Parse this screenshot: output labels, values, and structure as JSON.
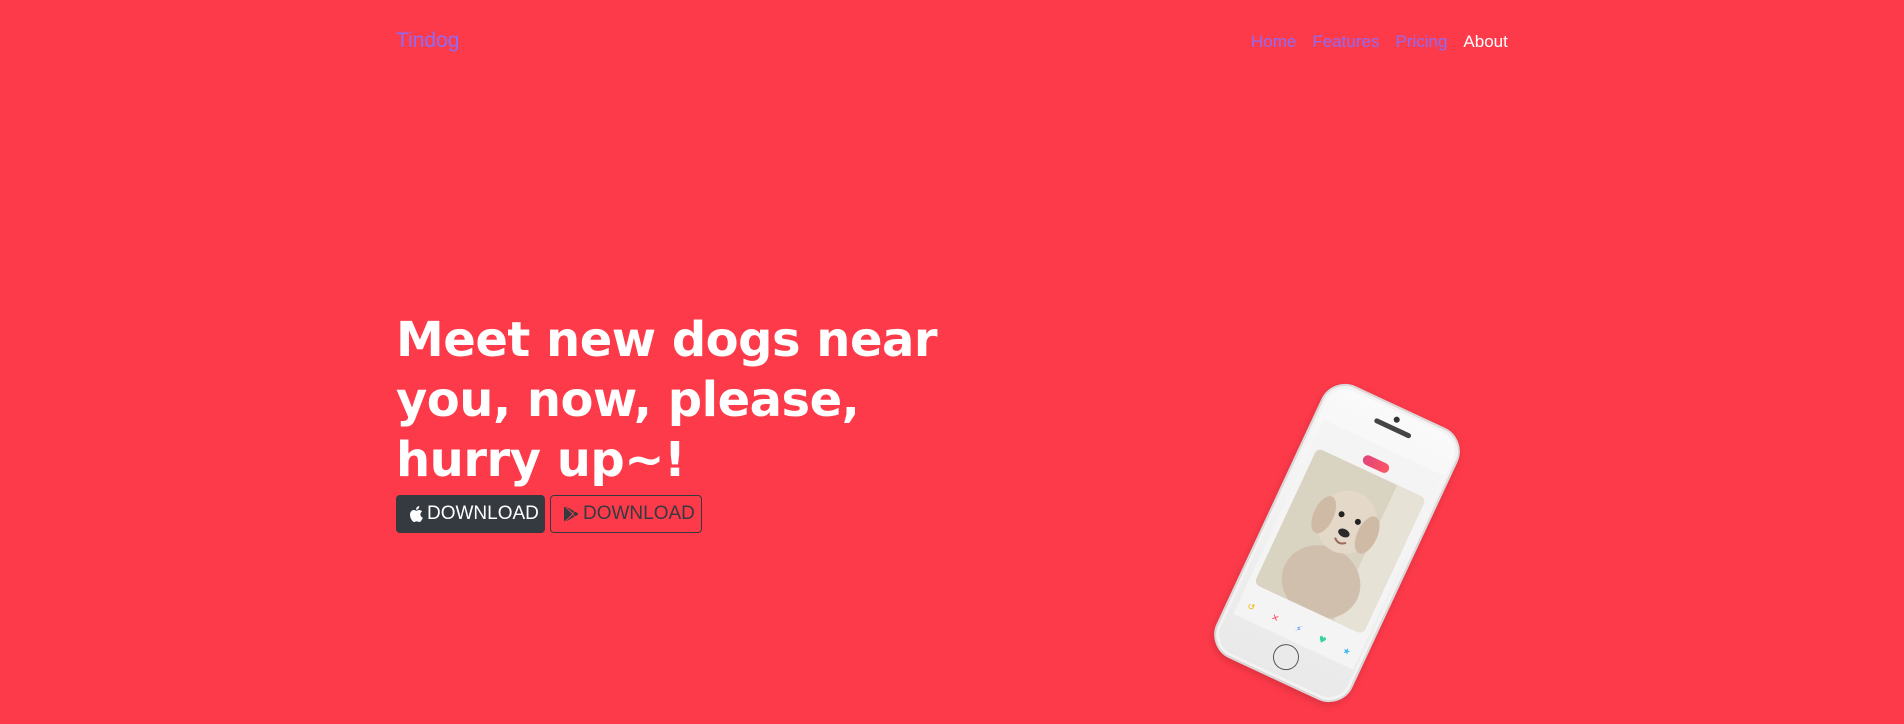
{
  "navbar": {
    "brand": "Tindog",
    "links": [
      {
        "label": "Home"
      },
      {
        "label": "Features"
      },
      {
        "label": "Pricing"
      },
      {
        "label": "About"
      }
    ]
  },
  "hero": {
    "title_line1": "Meet new dogs near",
    "title_line2": "you, now, please,",
    "title_line3": "hurry up~!",
    "apple_download_label": "DOWNLOAD",
    "play_download_label": "DOWNLOAD"
  },
  "colors": {
    "background": "#fd3a4a",
    "nav_link": "#8f6bf5",
    "nav_active": "#ffffff",
    "button_dark": "#343a40"
  },
  "icons": {
    "apple": "apple-icon",
    "play": "play-store-icon"
  }
}
